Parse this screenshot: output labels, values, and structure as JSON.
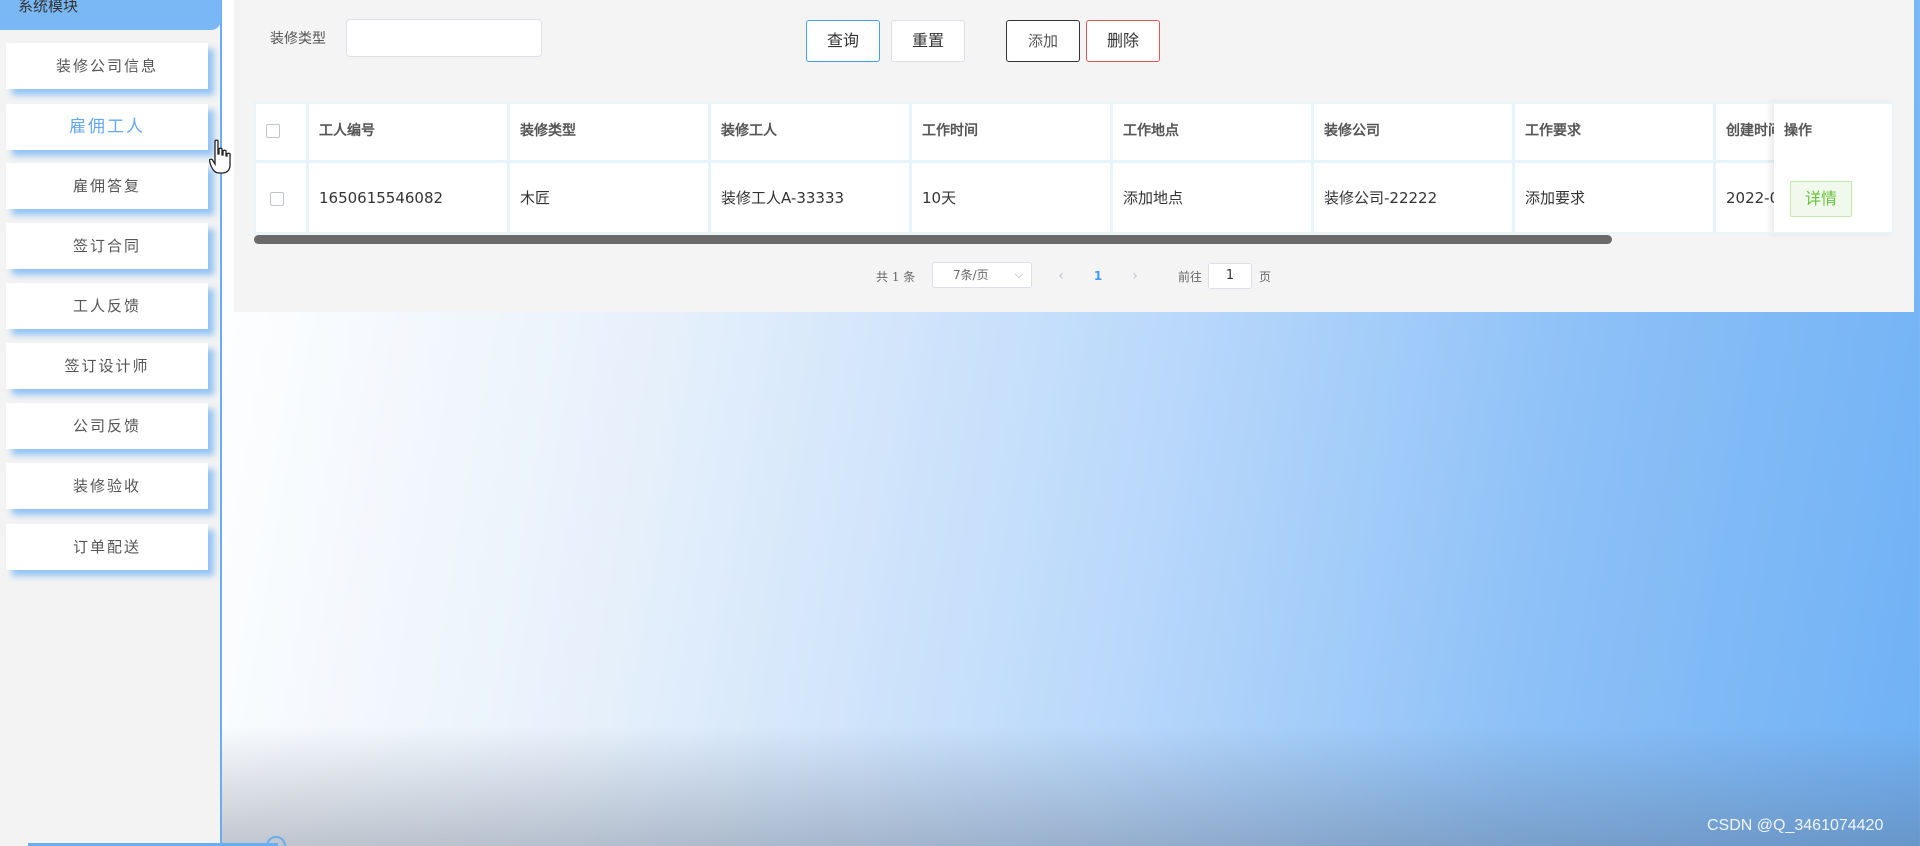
{
  "sidebar": {
    "header": "系统模块",
    "items": [
      {
        "label": "装修公司信息"
      },
      {
        "label": "雇佣工人"
      },
      {
        "label": "雇佣答复"
      },
      {
        "label": "签订合同"
      },
      {
        "label": "工人反馈"
      },
      {
        "label": "签订设计师"
      },
      {
        "label": "公司反馈"
      },
      {
        "label": "装修验收"
      },
      {
        "label": "订单配送"
      }
    ]
  },
  "search": {
    "label": "装修类型",
    "placeholder": ""
  },
  "toolbar": {
    "query_label": "查询",
    "reset_label": "重置",
    "add_label": "添加",
    "delete_label": "删除"
  },
  "table": {
    "headers": [
      "工人编号",
      "装修类型",
      "装修工人",
      "工作时间",
      "工作地点",
      "装修公司",
      "工作要求",
      "创建时间",
      "操作"
    ],
    "rows": [
      {
        "cells": [
          "1650615546082",
          "木匠",
          "装修工人A-33333",
          "10天",
          "添加地点",
          "装修公司-22222",
          "添加要求",
          "2022-0"
        ],
        "action_label": "详情"
      }
    ]
  },
  "pagination": {
    "total_label": "共 1 条",
    "page_size": "7条/页",
    "prev": "‹",
    "current_page": "1",
    "next": "›",
    "goto_label": "前往",
    "goto_value": "1",
    "page_suffix": "页"
  },
  "watermark": "CSDN @Q_3461074420"
}
